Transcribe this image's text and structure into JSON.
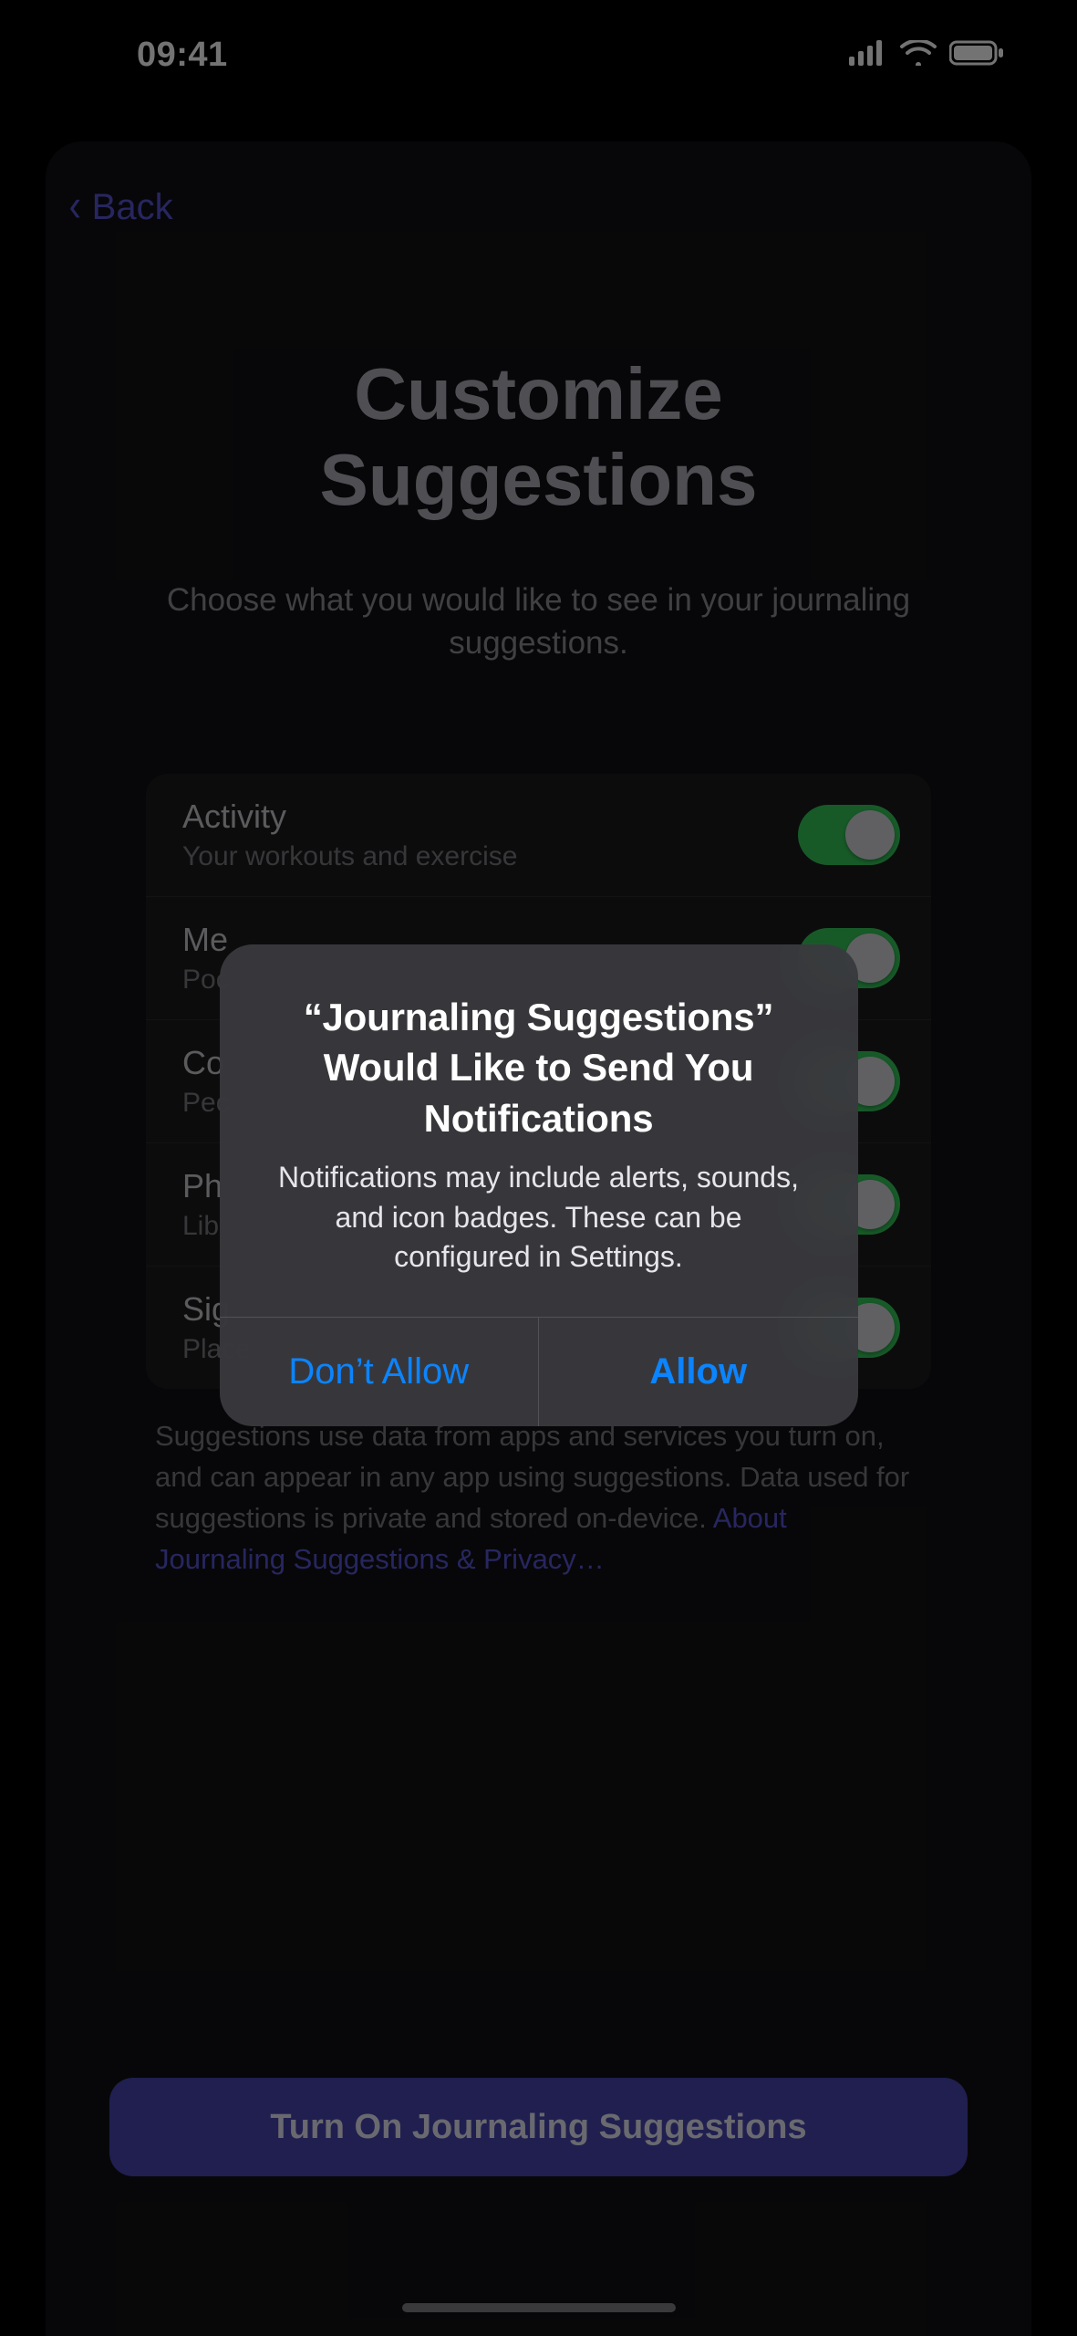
{
  "status": {
    "time": "09:41"
  },
  "nav": {
    "back_label": "Back"
  },
  "page": {
    "title_line1": "Customize",
    "title_line2": "Suggestions",
    "subtitle": "Choose what you would like to see in your journaling suggestions."
  },
  "rows": [
    {
      "title": "Activity",
      "sub": "Your workouts and exercise"
    },
    {
      "title": "Me",
      "sub": "Poc"
    },
    {
      "title": "Co",
      "sub": "Pec"
    },
    {
      "title": "Ph",
      "sub": "Lib"
    },
    {
      "title": "Sig",
      "sub": "Places"
    }
  ],
  "footer": {
    "text": "Suggestions use data from apps and services you turn on, and can appear in any app using suggestions. Data used for suggestions is private and stored on-device. ",
    "link": "About Journaling Suggestions & Privacy…"
  },
  "primary_button": "Turn On Journaling Suggestions",
  "alert": {
    "title": "“Journaling Suggestions” Would Like to Send You Notifications",
    "message": "Notifications may include alerts, sounds, and icon badges. These can be configured in Settings.",
    "deny": "Don’t Allow",
    "allow": "Allow"
  }
}
